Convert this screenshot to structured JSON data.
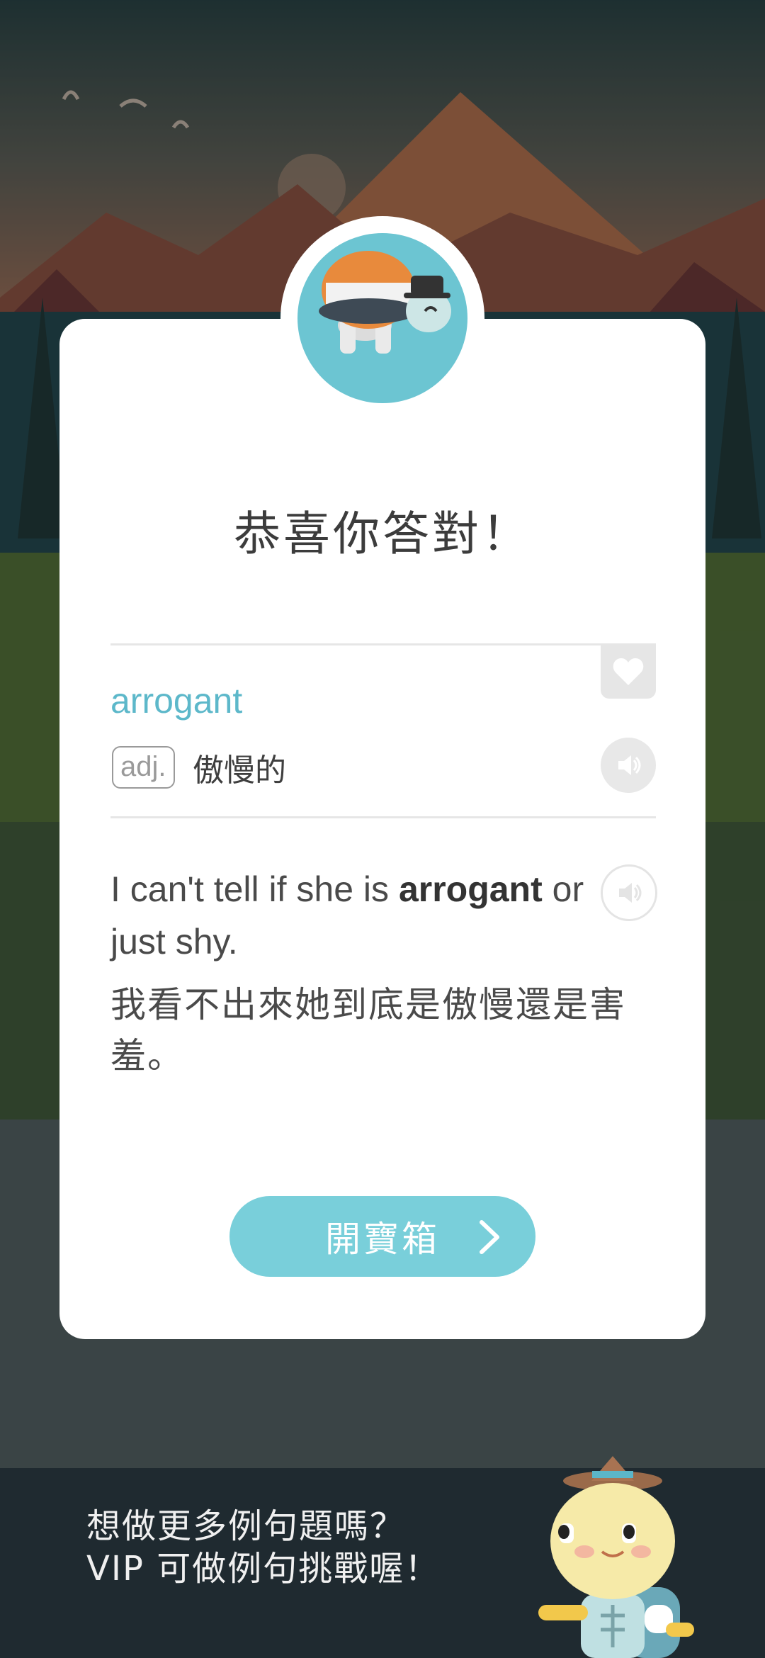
{
  "dialog": {
    "title": "恭喜你答對！",
    "word": "arrogant",
    "part_of_speech": "adj.",
    "meaning": "傲慢的",
    "sentence_before": "I can't tell if she is ",
    "sentence_highlight": "arrogant",
    "sentence_after": " or just shy.",
    "translation": "我看不出來她到底是傲慢還是害羞。",
    "cta_label": "開寶箱"
  },
  "banner": {
    "line1": "想做更多例句題嗎？",
    "line2": "VIP 可做例句挑戰喔！"
  },
  "icons": {
    "favorite": "heart-icon",
    "word_audio": "speaker-icon",
    "sentence_audio": "speaker-outline-icon",
    "next": "chevron-right-icon"
  },
  "colors": {
    "accent": "#5db8ca",
    "button": "#79cfda",
    "banner_bg": "#1f2a30"
  }
}
